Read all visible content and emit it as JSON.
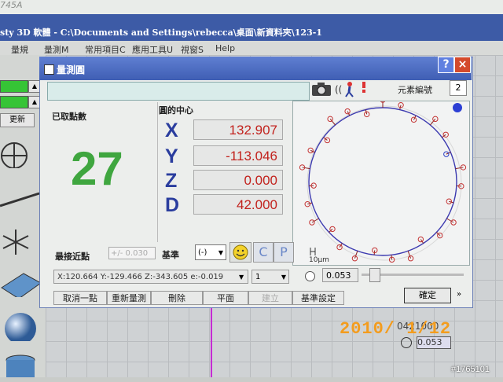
{
  "background_app": {
    "model_text": "745A",
    "title": "sty 3D 軟體 - C:\\Documents and Settings\\rebecca\\桌面\\新資料夾\\123-1",
    "menu": [
      "量規",
      "量測M",
      "常用項目C",
      "應用工具U",
      "視窗S",
      "Help"
    ],
    "update_button": "更新",
    "bottom_status": "0421000",
    "bottom_field": "0.053"
  },
  "dialog": {
    "title": "量測圓",
    "help_label": "?",
    "close_label": "×",
    "element_number_label": "元素編號",
    "element_number": "2",
    "points": {
      "label": "已取點數",
      "value": "27"
    },
    "center": {
      "label": "圓的中心",
      "rows": [
        {
          "axis": "X",
          "value": "132.907"
        },
        {
          "axis": "Y",
          "value": "-113.046"
        },
        {
          "axis": "Z",
          "value": "0.000"
        },
        {
          "axis": "D",
          "value": "42.000"
        }
      ]
    },
    "plot": {
      "scale_label": "10μm"
    },
    "nearest": {
      "label": "最接近點",
      "value": "+/- 0.030"
    },
    "datum": {
      "label": "基準",
      "selected": "(-)"
    },
    "c_label": "C",
    "p_label": "P",
    "status_readout": "X:120.664 Y:-129.466 Z:-343.605 e:-0.019",
    "count_select": "1",
    "fit_value": "0.053",
    "buttons": [
      "取消一點",
      "重新量測",
      "刪除",
      "平面",
      "建立",
      "基準設定"
    ],
    "ok_label": "確定",
    "more_label": "»"
  },
  "overlay": {
    "date_stamp": "2010/ 1/12",
    "watermark": "#1765101"
  }
}
